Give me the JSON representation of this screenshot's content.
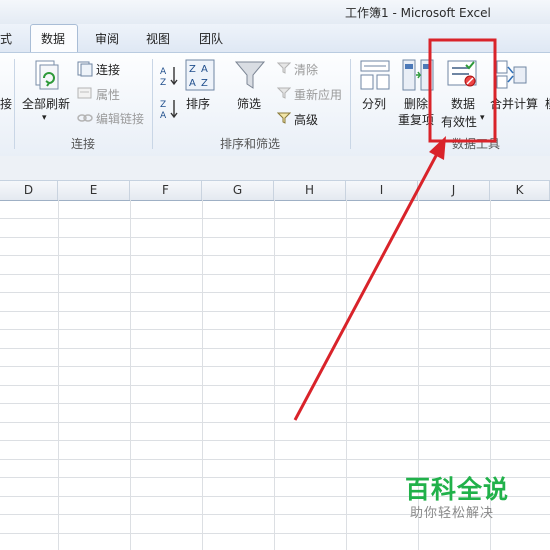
{
  "window": {
    "title": "工作簿1  -  Microsoft Excel"
  },
  "tabs": [
    {
      "label": "式"
    },
    {
      "label": "数据"
    },
    {
      "label": "审阅"
    },
    {
      "label": "视图"
    },
    {
      "label": "团队"
    }
  ],
  "ribbon": {
    "connections": {
      "partial_label": "接",
      "refresh_all": "全部刷新",
      "connections": "连接",
      "properties": "属性",
      "edit_links": "编辑链接",
      "group_label": "连接"
    },
    "sort_filter": {
      "sort": "排序",
      "filter": "筛选",
      "clear": "清除",
      "reapply": "重新应用",
      "advanced": "高级",
      "group_label": "排序和筛选"
    },
    "data_tools": {
      "text_to_columns": "分列",
      "remove_duplicates_line1": "删除",
      "remove_duplicates_line2": "重复项",
      "data_validation_line1": "数据",
      "data_validation_line2": "有效性",
      "consolidate": "合并计算",
      "partial_next": "模",
      "group_label": "数据工具"
    }
  },
  "columns": [
    "D",
    "E",
    "F",
    "G",
    "H",
    "I",
    "J",
    "K"
  ],
  "watermark": {
    "title": "百科全说",
    "subtitle": "助你轻松解决"
  },
  "colors": {
    "highlight": "#d9232a",
    "arrow": "#d9232a",
    "watermark": "#21b14a"
  }
}
